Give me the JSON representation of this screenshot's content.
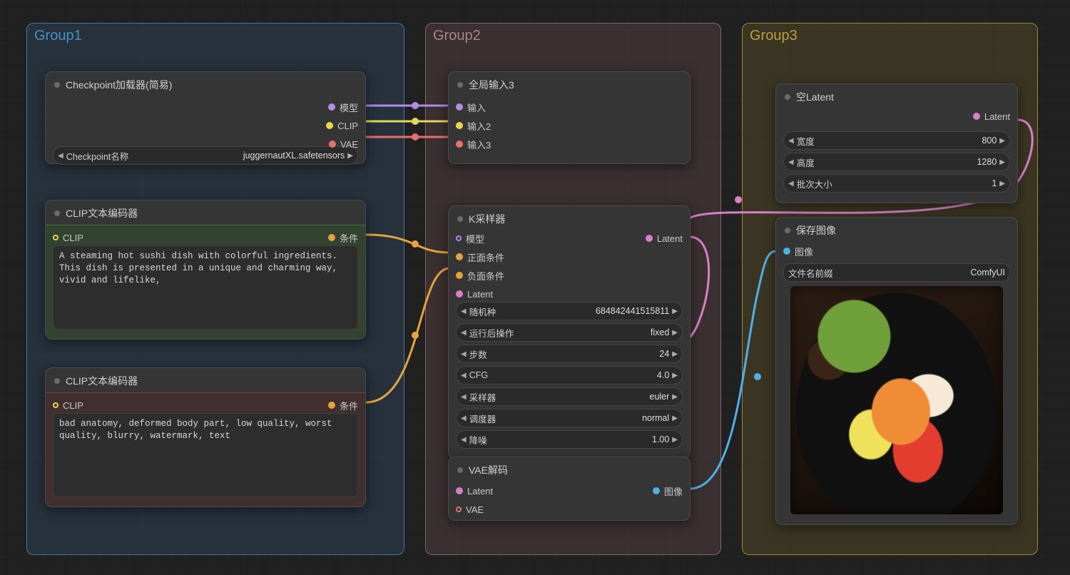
{
  "groups": {
    "g1": "Group1",
    "g2": "Group2",
    "g3": "Group3"
  },
  "ckpt": {
    "title": "Checkpoint加载器(简易)",
    "out_model": "模型",
    "out_clip": "CLIP",
    "out_vae": "VAE",
    "widget_label": "Checkpoint名称",
    "widget_value": "juggernautXL.safetensors"
  },
  "clip_pos": {
    "title": "CLIP文本编码器",
    "in_clip": "CLIP",
    "out_cond": "条件",
    "text": "A steaming hot sushi dish with colorful ingredients. This dish is presented in a unique and charming way, vivid and lifelike,"
  },
  "clip_neg": {
    "title": "CLIP文本编码器",
    "in_clip": "CLIP",
    "out_cond": "条件",
    "text": "bad anatomy, deformed body part, low quality, worst quality, blurry, watermark, text"
  },
  "globals": {
    "title": "全局输入3",
    "in1": "输入",
    "in2": "输入2",
    "in3": "输入3"
  },
  "ksamp": {
    "title": "K采样器",
    "in_model": "模型",
    "in_pos": "正面条件",
    "in_neg": "负面条件",
    "in_latent": "Latent",
    "out_latent": "Latent",
    "seed_label": "随机种",
    "seed_value": "684842441515811",
    "after_label": "运行后操作",
    "after_value": "fixed",
    "steps_label": "步数",
    "steps_value": "24",
    "cfg_label": "CFG",
    "cfg_value": "4.0",
    "sampler_label": "采样器",
    "sampler_value": "euler",
    "sched_label": "调度器",
    "sched_value": "normal",
    "denoise_label": "降噪",
    "denoise_value": "1.00"
  },
  "vaedec": {
    "title": "VAE解码",
    "in_latent": "Latent",
    "in_vae": "VAE",
    "out_image": "图像"
  },
  "latent": {
    "title": "空Latent",
    "out_latent": "Latent",
    "w_label": "宽度",
    "w_value": "800",
    "h_label": "高度",
    "h_value": "1280",
    "b_label": "批次大小",
    "b_value": "1"
  },
  "save": {
    "title": "保存图像",
    "in_image": "图像",
    "prefix_label": "文件名前缀",
    "prefix_value": "ComfyUI"
  }
}
